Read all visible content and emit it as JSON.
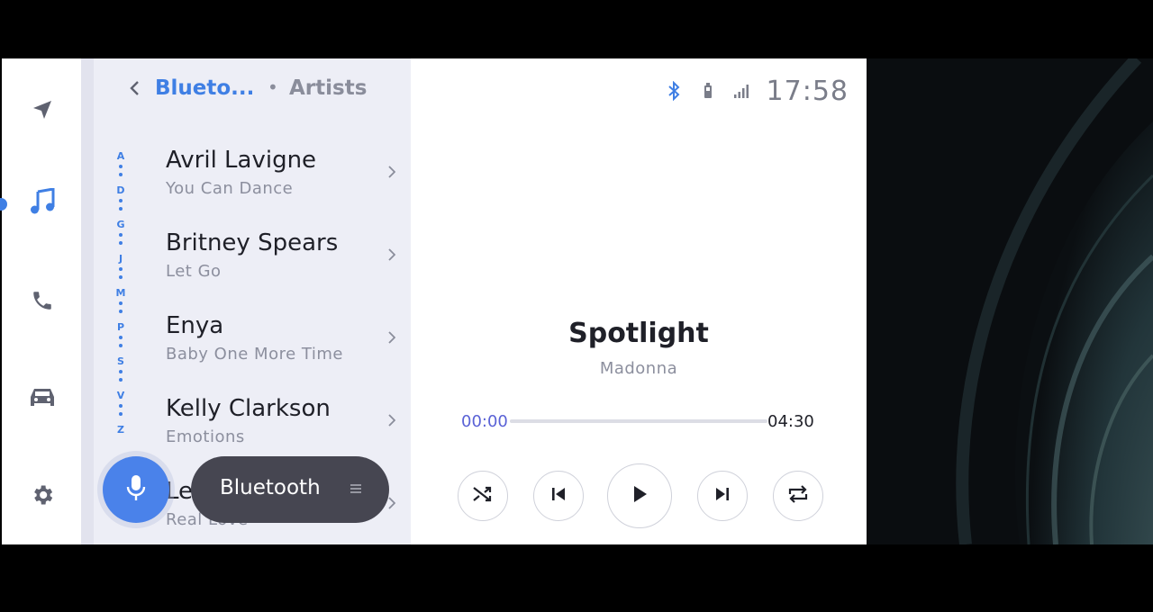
{
  "nav": {
    "items": [
      {
        "name": "navigation",
        "icon": "navigation-arrow-icon",
        "active": false
      },
      {
        "name": "media",
        "icon": "music-note-icon",
        "active": true
      },
      {
        "name": "phone",
        "icon": "phone-icon",
        "active": false
      },
      {
        "name": "vehicle",
        "icon": "car-icon",
        "active": false
      },
      {
        "name": "settings",
        "icon": "gear-icon",
        "active": false
      }
    ]
  },
  "list": {
    "breadcrumb_source": "Blueto...",
    "breadcrumb_separator": "•",
    "breadcrumb_page": "Artists",
    "alpha_index": [
      "A",
      "D",
      "G",
      "J",
      "M",
      "P",
      "S",
      "V",
      "Z"
    ],
    "artists": [
      {
        "name": "Avril Lavigne",
        "subtitle": "You Can Dance"
      },
      {
        "name": "Britney Spears",
        "subtitle": "Let Go"
      },
      {
        "name": "Enya",
        "subtitle": "Baby One More Time"
      },
      {
        "name": "Kelly Clarkson",
        "subtitle": "Emotions"
      },
      {
        "name": "Le",
        "subtitle": "Real Love"
      }
    ]
  },
  "source_pill": {
    "label": "Bluetooth"
  },
  "status": {
    "time": "17:58"
  },
  "player": {
    "title": "Spotlight",
    "artist": "Madonna",
    "elapsed": "00:00",
    "duration": "04:30",
    "progress": 0.0
  },
  "colors": {
    "accent": "#3f7fe4",
    "progress": "#5a62d6",
    "pill": "#464651"
  }
}
